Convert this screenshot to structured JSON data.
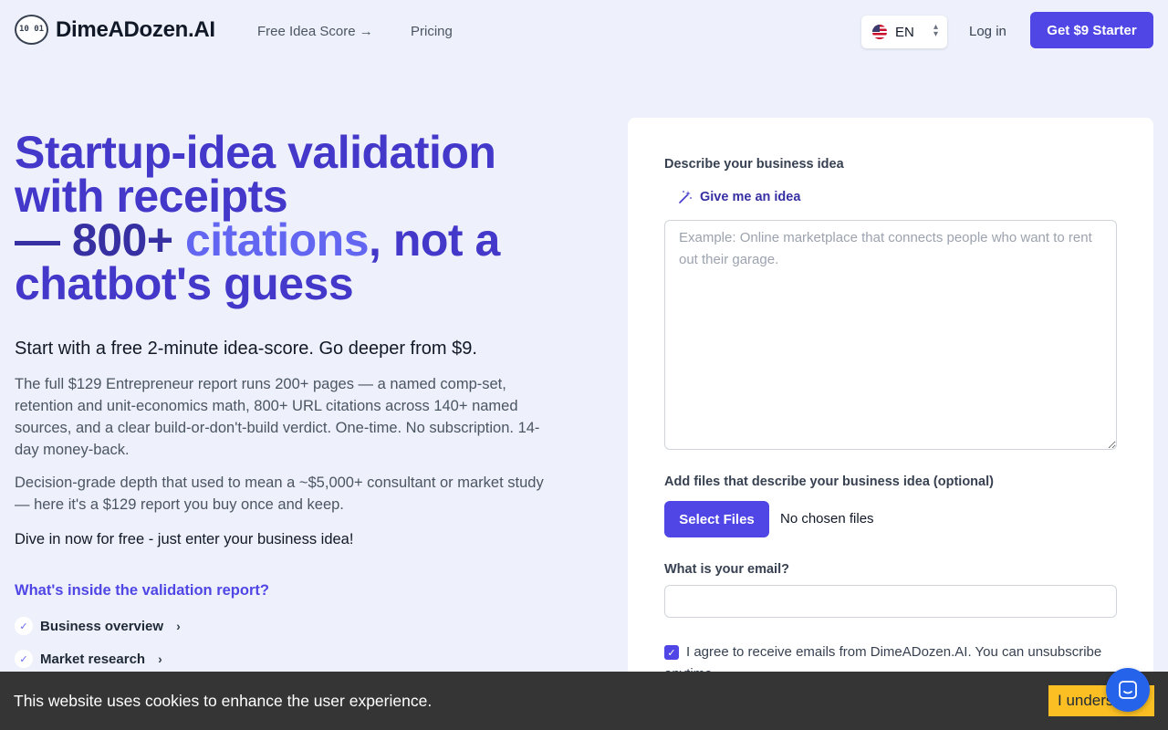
{
  "header": {
    "logo_mark": "10 01",
    "logo_text": "DimeADozen.AI",
    "nav": [
      {
        "label": "Free Idea Score →"
      },
      {
        "label": "Pricing"
      }
    ],
    "language": "EN",
    "login_label": "Log in",
    "cta_label": "Get $9 Starter"
  },
  "hero": {
    "title_line1": "Startup-idea validation",
    "title_line2": "with receipts",
    "title_dash": "— ",
    "title_number": "800+",
    "title_citations": "citations",
    "title_rest": ", not a",
    "title_line4": "chatbot's guess",
    "subtitle": "Start with a free 2-minute idea-score. Go deeper from $9.",
    "paragraph1": "The full $129 Entrepreneur report runs 200+ pages — a named comp-set, retention and unit-economics math, 800+ URL citations across 140+ named sources, and a clear build-or-don't-build verdict. One-time. No subscription. 14-day money-back.",
    "paragraph2": "Decision-grade depth that used to mean a ~$5,000+ consultant or market study — here it's a $129 report you buy once and keep.",
    "dive_in": "Dive in now for free - just enter your business idea!",
    "inside_title": "What's inside the validation report?",
    "inside_items": [
      {
        "label": "Business overview"
      },
      {
        "label": "Market research"
      }
    ]
  },
  "form": {
    "describe_label": "Describe your business idea",
    "give_idea_label": "Give me an idea",
    "idea_placeholder": "Example: Online marketplace that connects people who want to rent out their garage.",
    "files_label": "Add files that describe your business idea (optional)",
    "select_files_label": "Select Files",
    "no_files_text": "No chosen files",
    "email_label": "What is your email?",
    "email_value": "",
    "agree_text": "I agree to receive emails from DimeADozen.AI. You can unsubscribe anytime."
  },
  "cookie": {
    "text": "This website uses cookies to enhance the user experience.",
    "button_label": "I understand"
  },
  "colors": {
    "accent": "#4f46e5",
    "title": "#4338ca",
    "cookie_bg": "#353535",
    "cookie_button": "#fbbf24",
    "chat": "#2563eb"
  }
}
